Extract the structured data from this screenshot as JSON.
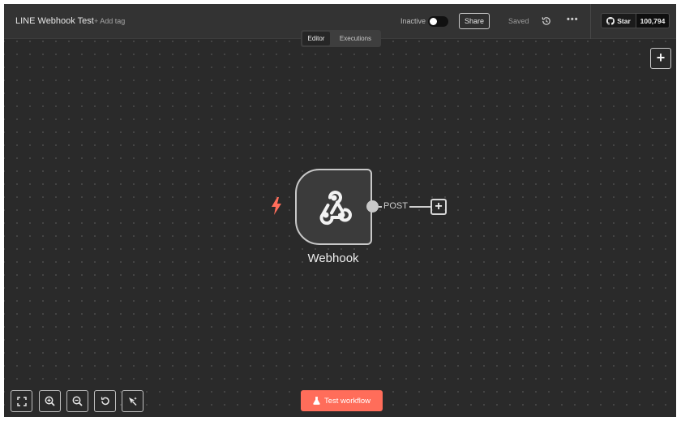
{
  "header": {
    "workflow_name": "LINE Webhook Test",
    "add_tag": "+ Add tag",
    "status_label": "Inactive",
    "active": false,
    "share_label": "Share",
    "saved_label": "Saved",
    "more_label": "•••",
    "github": {
      "star_label": "Star",
      "star_count": "100,794"
    }
  },
  "tabs": [
    {
      "label": "Editor",
      "active": true
    },
    {
      "label": "Executions",
      "active": false
    }
  ],
  "canvas": {
    "add_button_label": "+",
    "node": {
      "label": "Webhook",
      "icon": "webhook-icon",
      "trigger_icon": "lightning-icon",
      "output_label": "POST",
      "add_label": "+"
    }
  },
  "toolbar": {
    "buttons": [
      "fit-view-icon",
      "zoom-in-icon",
      "zoom-out-icon",
      "reset-zoom-icon",
      "tidy-up-icon"
    ],
    "test_label": "Test workflow"
  },
  "colors": {
    "canvas_bg": "#2a2a2a",
    "header_bg": "#333333",
    "accent": "#ff6d5a"
  }
}
